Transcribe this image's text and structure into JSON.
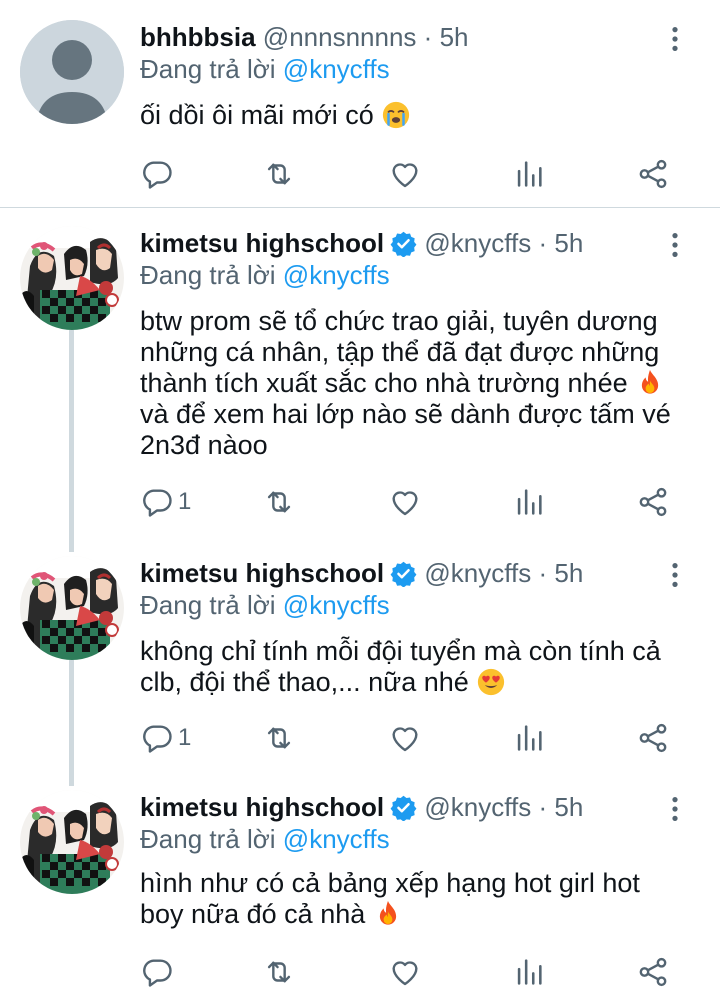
{
  "colors": {
    "link": "#1d9bf0",
    "secondary": "#536471",
    "text": "#0f1419",
    "divider": "#cfd9de"
  },
  "tweets": [
    {
      "name": "bhhbbsia",
      "handle": "@nnnsnnnns",
      "dot": "·",
      "time": "5h",
      "verified": false,
      "replying_prefix": "Đang trả lời",
      "replying_to": "@knycffs",
      "text": "ối dồi ôi mãi mới có",
      "emoji": "crying-face",
      "reply_count": ""
    },
    {
      "name": "kimetsu highschool",
      "handle": "@knycffs",
      "dot": "·",
      "time": "5h",
      "verified": true,
      "replying_prefix": "Đang trả lời",
      "replying_to": "@knycffs",
      "lines": [
        "btw prom sẽ tổ chức trao giải, tuyên dương",
        "những cá nhân, tập thể đã đạt được những",
        "thành tích xuất sắc cho nhà trường nhée",
        "và để xem hai lớp nào sẽ dành được tấm vé",
        "2n3đ nàoo"
      ],
      "emoji": "fire",
      "reply_count": "1"
    },
    {
      "name": "kimetsu highschool",
      "handle": "@knycffs",
      "dot": "·",
      "time": "5h",
      "verified": true,
      "replying_prefix": "Đang trả lời",
      "replying_to": "@knycffs",
      "lines": [
        "không chỉ tính mỗi đội tuyển mà còn tính cả",
        "clb, đội thể thao,... nữa nhé"
      ],
      "emoji": "heart-eyes",
      "reply_count": "1"
    },
    {
      "name": "kimetsu highschool",
      "handle": "@knycffs",
      "dot": "·",
      "time": "5h",
      "verified": true,
      "replying_prefix": "Đang trả lời",
      "replying_to": "@knycffs",
      "lines": [
        "hình như có cả bảng xếp hạng hot girl hot",
        "boy nữa đó cả nhà"
      ],
      "emoji": "fire",
      "reply_count": ""
    }
  ]
}
